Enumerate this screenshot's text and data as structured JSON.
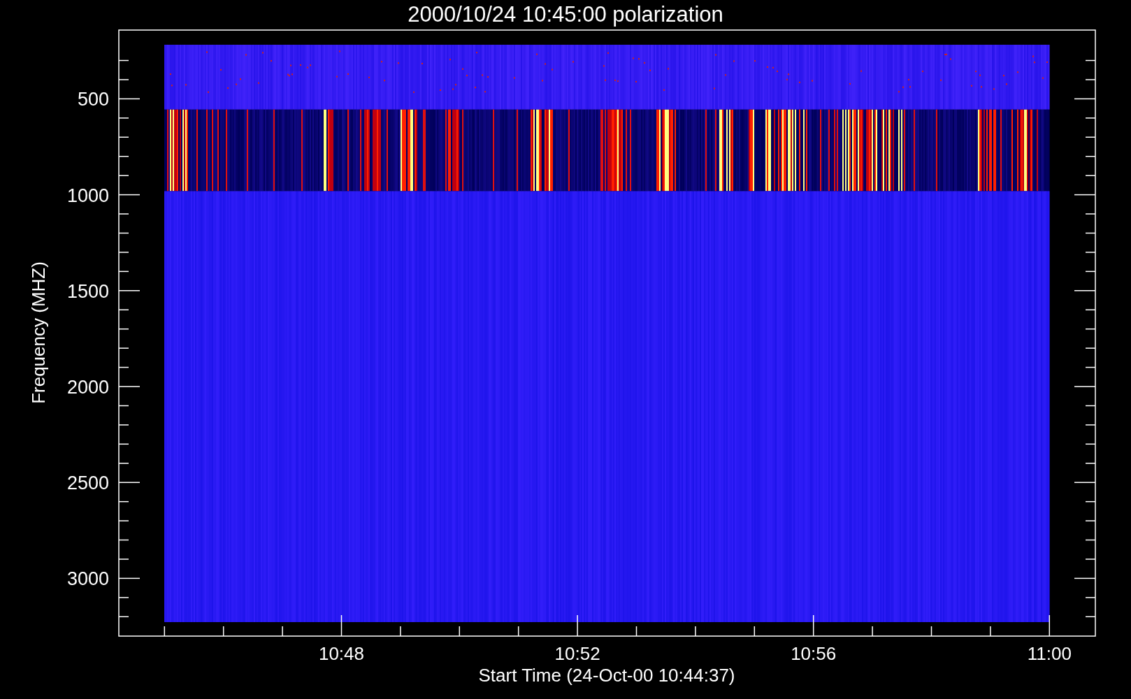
{
  "title": "2000/10/24 10:45:00 polarization",
  "y_axis": {
    "label": "Frequency (MHZ)",
    "ticks": [
      "500",
      "1000",
      "1500",
      "2000",
      "2500",
      "3000"
    ]
  },
  "x_axis": {
    "label": "Start Time (24-Oct-00 10:44:37)",
    "ticks": [
      "10:48",
      "10:52",
      "10:56",
      "11:00"
    ]
  }
}
